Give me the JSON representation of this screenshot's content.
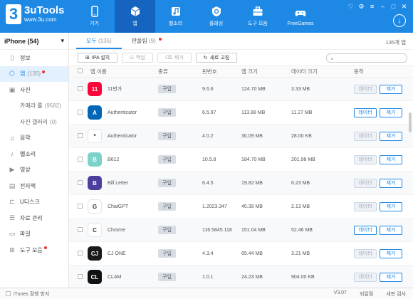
{
  "app": {
    "name": "3uTools",
    "url": "www.3u.com",
    "mark": "3"
  },
  "nav": [
    {
      "label": "기기",
      "icon": "phone-icon"
    },
    {
      "label": "앱",
      "icon": "cube-icon"
    },
    {
      "label": "벨소리",
      "icon": "music-icon"
    },
    {
      "label": "플래싱",
      "icon": "flash-icon"
    },
    {
      "label": "도구 모음",
      "icon": "toolbox-icon"
    },
    {
      "label": "FreeGames",
      "icon": "gamepad-icon"
    }
  ],
  "sidebar": {
    "device": "iPhone (54)",
    "items": [
      {
        "label": "정보",
        "count": "",
        "icon": "phone-icon"
      },
      {
        "label": "앱",
        "count": "(135)",
        "icon": "cube-icon"
      },
      {
        "label": "사진",
        "count": "",
        "icon": "image-icon"
      },
      {
        "label": "카메라 롤",
        "count": "(9582)",
        "icon": ""
      },
      {
        "label": "사진 갤러리",
        "count": "(0)",
        "icon": ""
      },
      {
        "label": "음악",
        "count": "",
        "icon": "music-icon"
      },
      {
        "label": "벨소리",
        "count": "",
        "icon": "bell-icon"
      },
      {
        "label": "영상",
        "count": "",
        "icon": "video-icon"
      },
      {
        "label": "전자책",
        "count": "",
        "icon": "book-icon"
      },
      {
        "label": "U디스크",
        "count": "",
        "icon": "usb-icon"
      },
      {
        "label": "자료 관리",
        "count": "",
        "icon": "data-icon"
      },
      {
        "label": "파일",
        "count": "",
        "icon": "folder-icon"
      },
      {
        "label": "도구 모음",
        "count": "",
        "icon": "toolbox-icon"
      }
    ]
  },
  "tabs": {
    "all": "모두",
    "all_count": "(135)",
    "updates": "판올림",
    "updates_count": "(9)"
  },
  "total": "135개 앱",
  "toolbar": {
    "install": "IPA 설치",
    "backup": "백업",
    "delete": "제거",
    "refresh": "새로 고침"
  },
  "columns": {
    "name": "앱 이름",
    "type": "종류",
    "version": "판번호",
    "app_size": "앱 크기",
    "data_size": "데이터 크기",
    "action": "동작"
  },
  "buttons": {
    "data": "데이터",
    "remove": "제거",
    "buy": "구입"
  },
  "apps": [
    {
      "name": "11번가",
      "version": "9.6.6",
      "app_size": "124.70 MB",
      "data_size": "3.33 MB",
      "data_enabled": false,
      "icon_bg": "#ff0038",
      "icon_text": "11"
    },
    {
      "name": "Authenticator",
      "version": "6.5.97",
      "app_size": "113.88 MB",
      "data_size": "11.27 MB",
      "data_enabled": true,
      "icon_bg": "#0067b8",
      "icon_text": "A"
    },
    {
      "name": "Authenticator",
      "version": "4.0.2",
      "app_size": "30.09 MB",
      "data_size": "28.00 KB",
      "data_enabled": false,
      "icon_bg": "#ffffff",
      "icon_text": "*"
    },
    {
      "name": "B612",
      "version": "10.5.8",
      "app_size": "184.70 MB",
      "data_size": "201.98 MB",
      "data_enabled": false,
      "icon_bg": "#7dd3c9",
      "icon_text": "B"
    },
    {
      "name": "Bill Letter",
      "version": "6.4.5",
      "app_size": "19.82 MB",
      "data_size": "6.23 MB",
      "data_enabled": false,
      "icon_bg": "#4b3f9e",
      "icon_text": "B"
    },
    {
      "name": "ChatGPT",
      "version": "1.2023.347",
      "app_size": "40.39 MB",
      "data_size": "2.13 MB",
      "data_enabled": false,
      "icon_bg": "#ffffff",
      "icon_text": "G"
    },
    {
      "name": "Chrome",
      "version": "116.5845.118",
      "app_size": "151.04 MB",
      "data_size": "52.46 MB",
      "data_enabled": true,
      "icon_bg": "#ffffff",
      "icon_text": "C"
    },
    {
      "name": "CJ ONE",
      "version": "4.3.4",
      "app_size": "65.44 MB",
      "data_size": "3.21 MB",
      "data_enabled": false,
      "icon_bg": "#1a1a1a",
      "icon_text": "CJ"
    },
    {
      "name": "CLAM",
      "version": "1.0.1",
      "app_size": "24.23 MB",
      "data_size": "904.00 KB",
      "data_enabled": false,
      "icon_bg": "#111111",
      "icon_text": "CL"
    }
  ],
  "status": {
    "itunes": "iTunes 잠행 방지",
    "version": "V3.07",
    "feedback": "되알림",
    "update": "새판 검사"
  }
}
